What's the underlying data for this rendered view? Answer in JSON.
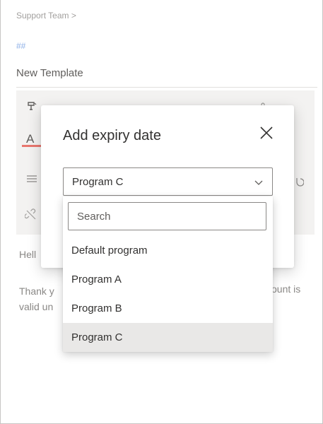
{
  "breadcrumb": {
    "label": "Support Team >"
  },
  "editor": {
    "placeholder_hash": "##",
    "template_name": "New Template",
    "body_greeting": "Hell",
    "body_line1": "Thank y",
    "body_line2": "valid un",
    "body_fragment": "ount is",
    "font_color_letter": "A",
    "accent_underline": "#e8766e"
  },
  "dialog": {
    "title": "Add expiry date",
    "close_icon": "close-icon",
    "select": {
      "value": "Program C",
      "chevron_icon": "chevron-down-icon"
    },
    "dropdown": {
      "search_placeholder": "Search",
      "options": [
        "Default program",
        "Program A",
        "Program B",
        "Program C"
      ],
      "selected_index": 3
    }
  },
  "colors": {
    "selected_bg": "#e9e8e7",
    "border": "#8a8886",
    "text": "#323130"
  }
}
